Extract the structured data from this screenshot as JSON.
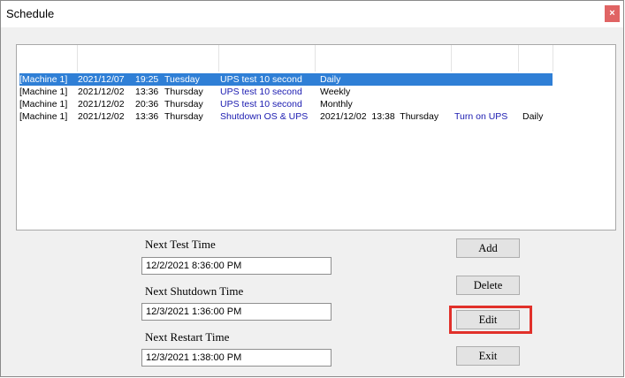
{
  "window": {
    "title": "Schedule",
    "close_glyph": "×"
  },
  "schedule_list": {
    "rows": [
      {
        "machine": "[Machine 1]",
        "date": "2021/12/07",
        "time": "19:25",
        "day": "Tuesday",
        "action": "UPS test 10 second",
        "col6": "Daily",
        "col7": "",
        "col8": "",
        "selected": true
      },
      {
        "machine": "[Machine 1]",
        "date": "2021/12/02",
        "time": "13:36",
        "day": "Thursday",
        "action": "UPS test 10 second",
        "col6": "Weekly",
        "col7": "",
        "col8": "",
        "selected": false
      },
      {
        "machine": "[Machine 1]",
        "date": "2021/12/02",
        "time": "20:36",
        "day": "Thursday",
        "action": "UPS test 10 second",
        "col6": "Monthly",
        "col7": "",
        "col8": "",
        "selected": false
      },
      {
        "machine": "[Machine 1]",
        "date": "2021/12/02",
        "time": "13:36",
        "day": "Thursday",
        "action": "Shutdown OS & UPS",
        "col6": "2021/12/02  13:38  Thursday",
        "col7": "Turn on UPS",
        "col8": "Daily",
        "selected": false
      }
    ]
  },
  "next_test": {
    "label": "Next Test Time",
    "value": "12/2/2021 8:36:00 PM"
  },
  "next_shutdown": {
    "label": "Next Shutdown Time",
    "value": "12/3/2021 1:36:00 PM"
  },
  "next_restart": {
    "label": "Next Restart Time",
    "value": "12/3/2021 1:38:00 PM"
  },
  "buttons": {
    "add": "Add",
    "delete": "Delete",
    "edit": "Edit",
    "exit": "Exit"
  },
  "colors": {
    "selection": "#2f7fd6",
    "highlight_box": "#e1302a",
    "action_text": "#1a1ab0"
  }
}
